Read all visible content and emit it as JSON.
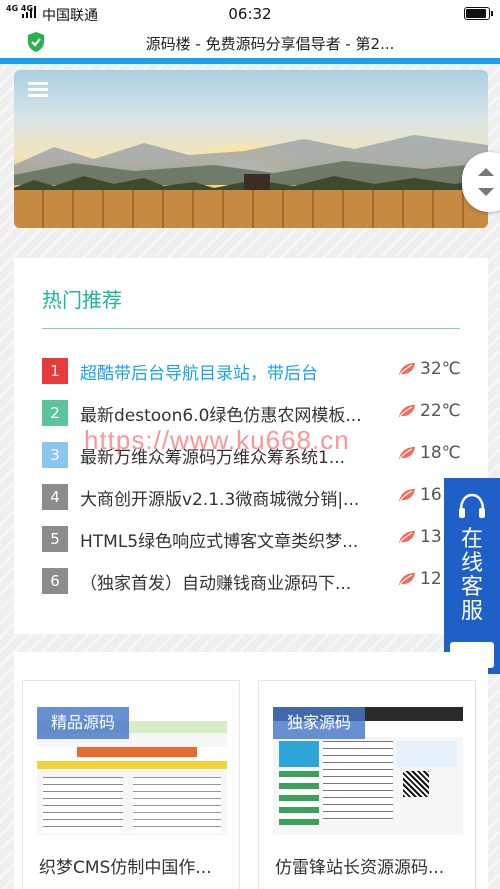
{
  "status_bar": {
    "network": "4G 4G",
    "carrier": "中国联通",
    "time": "06:32"
  },
  "browser": {
    "page_title": "源码楼 - 免费源码分享倡导者 - 第2..."
  },
  "icons": {
    "shield": "shield-check-icon",
    "menu": "menu-icon",
    "scroll": "scroll-updown-icon",
    "temperature": "leaf-icon",
    "headset": "headset-icon",
    "chat": "chat-icon"
  },
  "hot": {
    "heading": "热门推荐",
    "items": [
      {
        "rank": "1",
        "label": "超酷带后台导航目录站，带后台",
        "temp": "32℃",
        "color": "#e8393b",
        "highlight": true
      },
      {
        "rank": "2",
        "label": "最新destoon6.0绿色仿惠农网模板...",
        "temp": "22℃",
        "color": "#5cc49a",
        "highlight": false
      },
      {
        "rank": "3",
        "label": "最新万维众筹源码万维众筹系统1...",
        "temp": "18℃",
        "color": "#8cc5ee",
        "highlight": false
      },
      {
        "rank": "4",
        "label": "大商创开源版v2.1.3微商城微分销|...",
        "temp": "16",
        "color": "#8c8c8c",
        "highlight": false
      },
      {
        "rank": "5",
        "label": "HTML5绿色响应式博客文章类织梦...",
        "temp": "13",
        "color": "#8c8c8c",
        "highlight": false
      },
      {
        "rank": "6",
        "label": "（独家首发）自动赚钱商业源码下...",
        "temp": "12",
        "color": "#8c8c8c",
        "highlight": false
      }
    ]
  },
  "watermark": "https://www.ku668.cn",
  "service": {
    "label": "在线客服"
  },
  "sources": {
    "tiles": [
      {
        "tag": "精品源码",
        "name": "织梦CMS仿制中国作..."
      },
      {
        "tag": "独家源码",
        "name": "仿雷锋站长资源源码..."
      }
    ]
  },
  "colors": {
    "accent_blue": "#1aa3e8",
    "heading_teal": "#1bb59c",
    "service_blue": "#1e5fc8",
    "leaf_red": "#ef6b5b"
  }
}
